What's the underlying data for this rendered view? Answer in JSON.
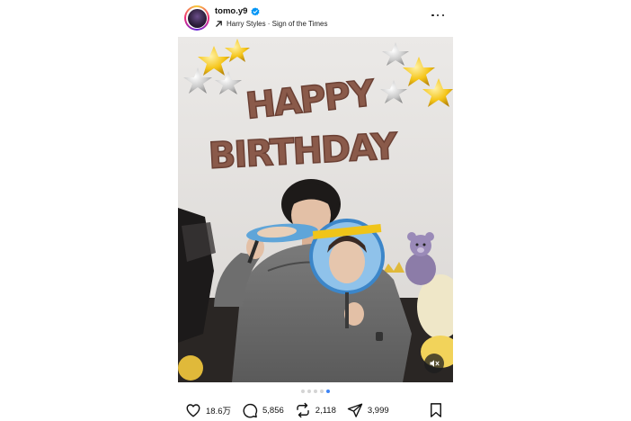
{
  "post": {
    "username": "tomo.y9",
    "verified": true,
    "audio_track": "Harry Styles · Sign of the Times",
    "banner_text": "HAPPY BIRTHDAY",
    "carousel": {
      "total": 5,
      "active_index": 4
    },
    "stats": {
      "likes": "18.6万",
      "comments": "5,856",
      "reposts": "2,118",
      "shares": "3,999"
    }
  },
  "icons": {
    "verified": "verified-badge-icon",
    "audio": "audio-arrow-icon",
    "more": "more-icon",
    "mute": "mute-icon",
    "like": "heart-icon",
    "comment": "comment-icon",
    "repost": "repost-icon",
    "share": "share-icon",
    "save": "bookmark-icon"
  },
  "colors": {
    "verified_blue": "#0095f6",
    "active_dot": "#3d84f5",
    "balloon_letters": "#8a5a4a",
    "balloon_gold": "#f5c518",
    "balloon_silver": "#c8c8c8"
  }
}
